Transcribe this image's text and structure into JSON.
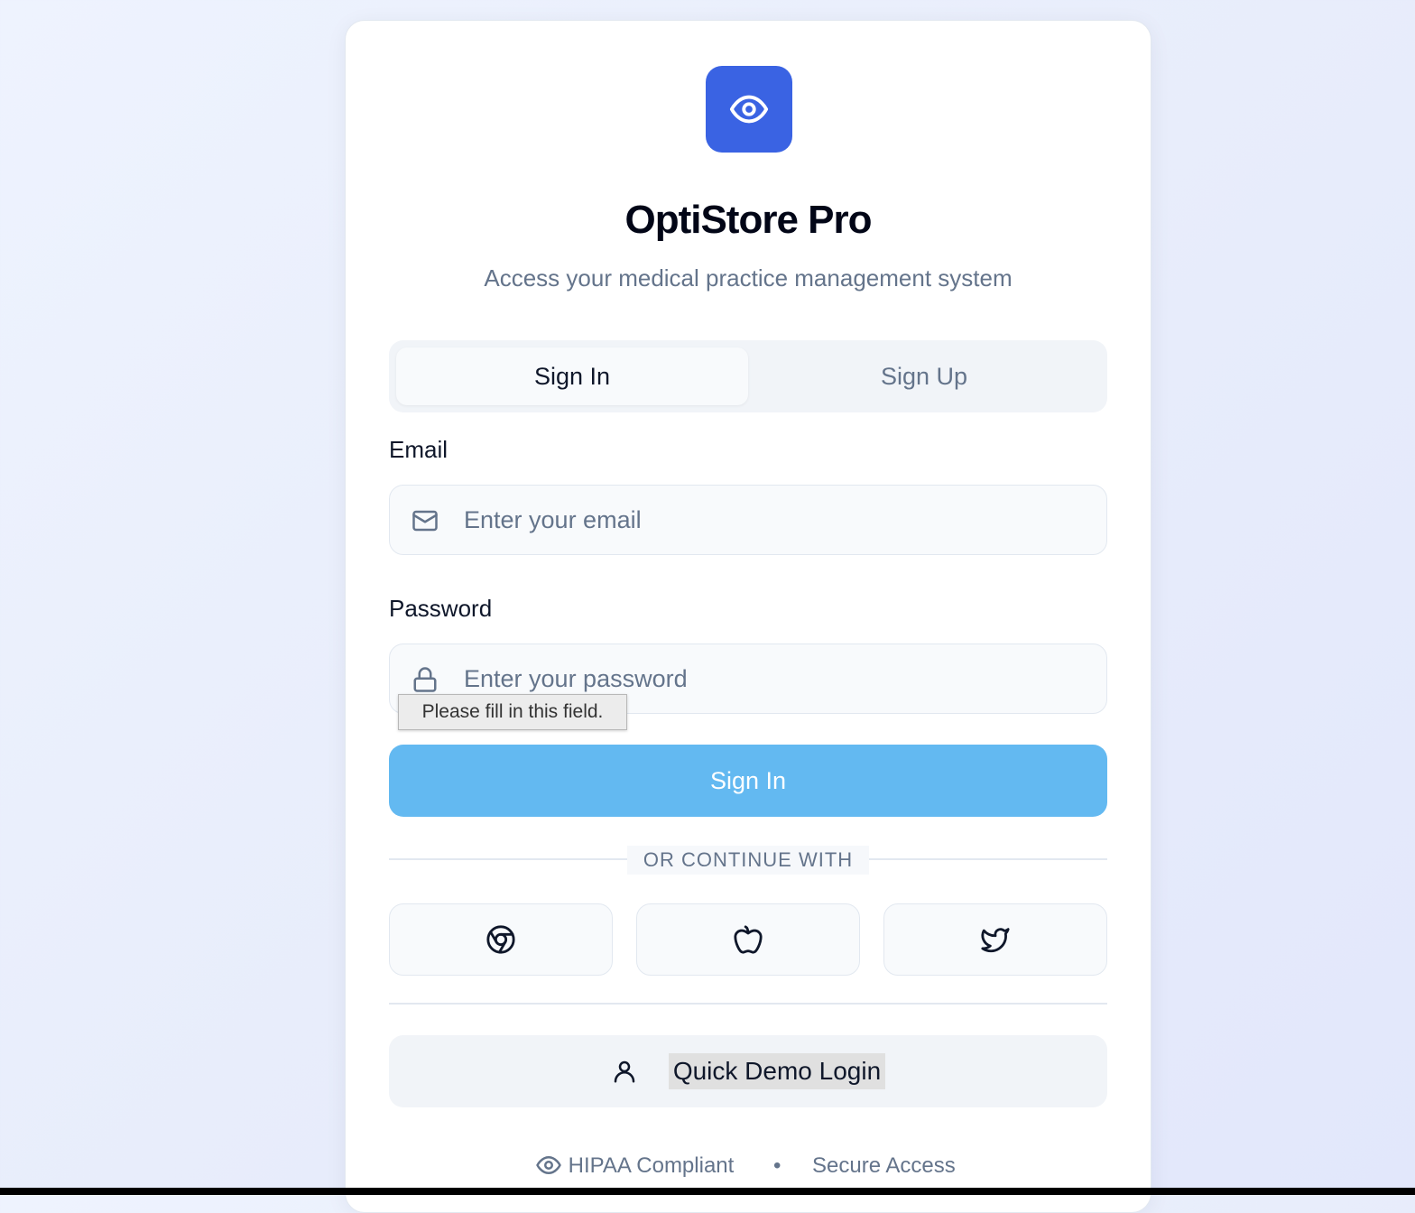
{
  "app": {
    "title": "OptiStore Pro",
    "subtitle": "Access your medical practice management system",
    "logo_icon": "eye-icon",
    "accent_color": "#3a63e3"
  },
  "tabs": [
    {
      "label": "Sign In",
      "active": true
    },
    {
      "label": "Sign Up",
      "active": false
    }
  ],
  "form": {
    "email": {
      "label": "Email",
      "placeholder": "Enter your email",
      "value": "",
      "icon": "mail-icon"
    },
    "password": {
      "label": "Password",
      "placeholder": "Enter your password",
      "value": "",
      "icon": "lock-icon"
    },
    "validation_tooltip": "Please fill in this field.",
    "submit_label": "Sign In",
    "submit_color": "#63b9f1"
  },
  "social": {
    "divider_text": "OR CONTINUE WITH",
    "providers": [
      {
        "icon": "chrome-icon"
      },
      {
        "icon": "apple-icon"
      },
      {
        "icon": "twitter-icon"
      }
    ]
  },
  "demo": {
    "label": "Quick Demo Login",
    "icon": "user-icon"
  },
  "footer": {
    "items": [
      "HIPAA Compliant",
      "Secure Access"
    ],
    "separator": "•",
    "icon": "eye-icon"
  }
}
